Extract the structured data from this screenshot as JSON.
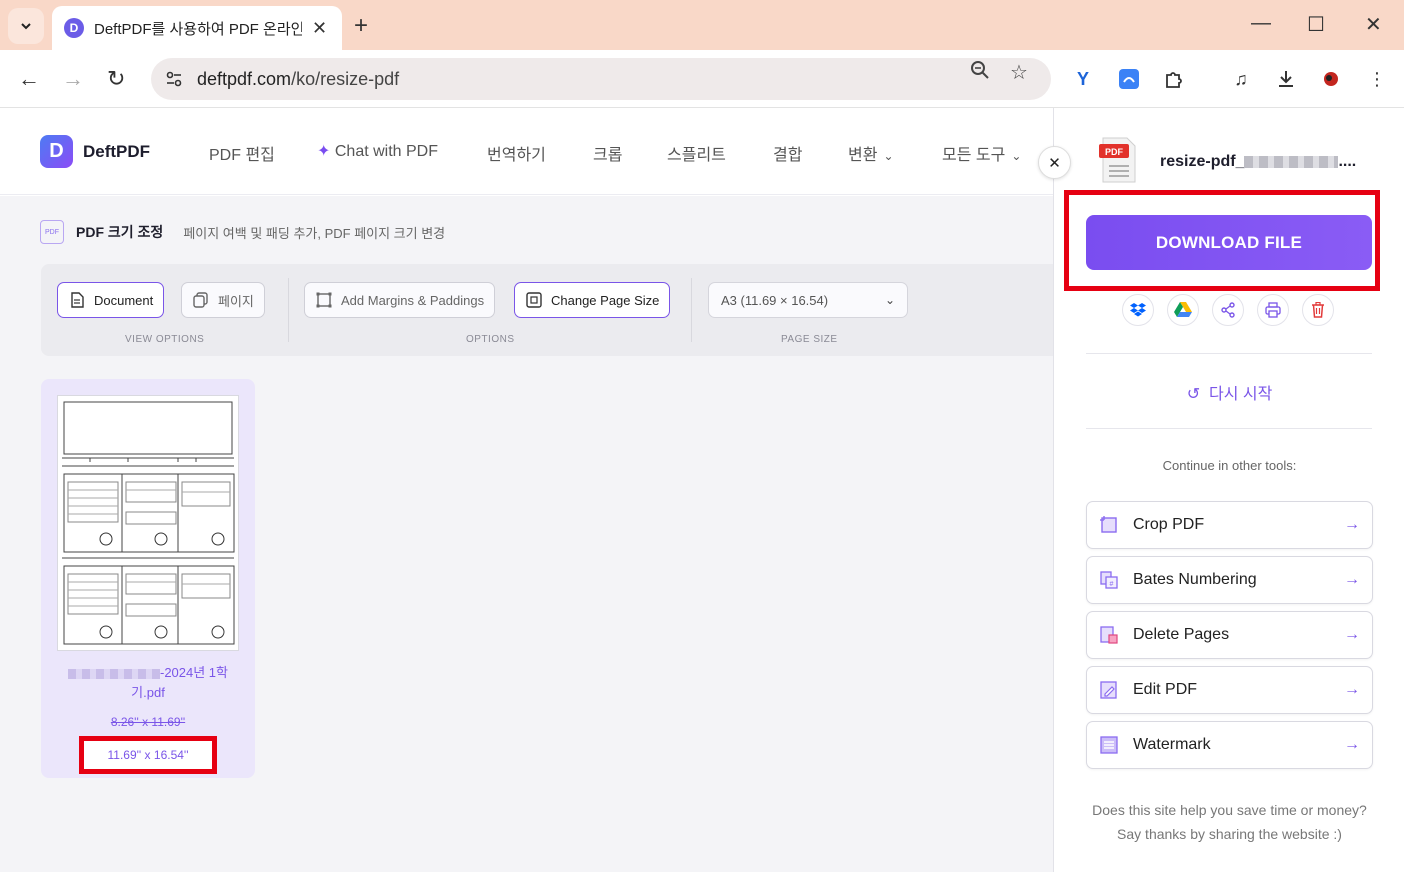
{
  "browser": {
    "tab_title": "DeftPDF를 사용하여 PDF 온라인",
    "tab_favicon": "D",
    "url_host": "deftpdf.com",
    "url_path": "/ko/resize-pdf"
  },
  "site": {
    "logo_letter": "D",
    "logo_text": "DeftPDF",
    "nav": [
      {
        "label": "PDF 편집"
      },
      {
        "label": "Chat with PDF"
      },
      {
        "label": "번역하기"
      },
      {
        "label": "크롭"
      },
      {
        "label": "스플리트"
      },
      {
        "label": "결합"
      },
      {
        "label": "변환"
      },
      {
        "label": "모든 도구"
      }
    ]
  },
  "tool": {
    "badge": "PDF",
    "title": "PDF 크기 조정",
    "subtitle": "페이지 여백 및 패딩 추가, PDF 페이지 크기 변경"
  },
  "options": {
    "view_document": "Document",
    "view_pages": "페이지",
    "view_label": "VIEW OPTIONS",
    "add_margins": "Add Margins & Paddings",
    "change_size": "Change Page Size",
    "options_label": "OPTIONS",
    "page_size_value": "A3 (11.69 × 16.54)",
    "page_size_label": "PAGE SIZE"
  },
  "file_card": {
    "name_suffix": "-2024년 1학",
    "name_line2": "기.pdf",
    "old_size": "8.26'' x 11.69''",
    "new_size": "11.69'' x 16.54''"
  },
  "panel": {
    "file_badge": "PDF",
    "file_name": "resize-pdf_",
    "file_name_tail": "....",
    "download": "DOWNLOAD FILE",
    "restart": "다시 시작",
    "continue": "Continue in other tools:",
    "tools": [
      {
        "label": "Crop PDF",
        "icon": "crop-icon"
      },
      {
        "label": "Bates Numbering",
        "icon": "bates-icon"
      },
      {
        "label": "Delete Pages",
        "icon": "delete-pages-icon"
      },
      {
        "label": "Edit PDF",
        "icon": "edit-icon"
      },
      {
        "label": "Watermark",
        "icon": "watermark-icon"
      }
    ],
    "thanks_line1": "Does this site help you save time or money?",
    "thanks_line2": "Say thanks by sharing the website :)"
  },
  "colors": {
    "accent": "#7a4df0",
    "highlight": "#e60012"
  }
}
